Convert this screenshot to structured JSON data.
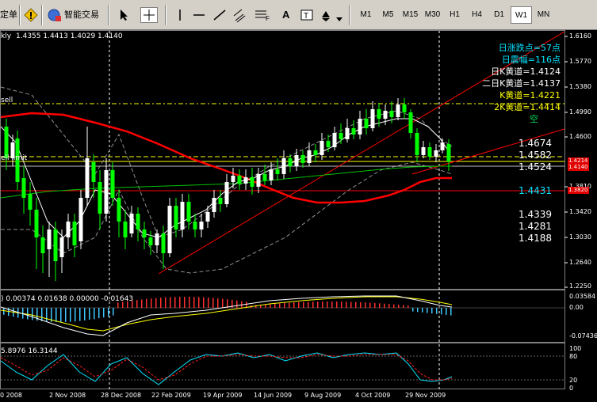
{
  "toolbar": {
    "label_left": "定单",
    "auto_trade_label": "智能交易",
    "text_tool_label": "A",
    "fib_tool_label": "F",
    "timeframes": [
      "M1",
      "M5",
      "M15",
      "M30",
      "H1",
      "H4",
      "D1",
      "W1",
      "MN"
    ],
    "active_timeframe": "W1"
  },
  "chart_header": {
    "symbol_suffix": "kly",
    "ohlc": "1.4355 1.4413 1.4029 1.4140"
  },
  "labels": {
    "sell": "sell",
    "sell_limit": "ell limit"
  },
  "info_panel": {
    "daily_change": "日涨跌点=57点",
    "daily_range": "日震幅=116点",
    "k_line1": "日K黄道=1.4124",
    "k_line2": "二日K黄道=1.4137",
    "k_line3": "K黄道=1.4221",
    "k_line4": "2K黄道=1.4414",
    "signal": "空"
  },
  "levels": {
    "l1": "1.4674",
    "l2": "1.4582",
    "l3": "1.4524",
    "l4": "1.4431",
    "l5": "1.4339",
    "l6": "1.4281",
    "l7": "1.4188"
  },
  "price_axis": [
    "1.6160",
    "1.5770",
    "1.5380",
    "1.4990",
    "1.4600",
    "1.3810",
    "1.3420",
    "1.3030",
    "1.2640",
    "1.2250"
  ],
  "price_boxes": {
    "upper1": "1.4214",
    "upper2": "1.4140",
    "lower": "1.3820"
  },
  "macd": {
    "values": ") 0.00374 0.01638 0.00000 -0.01643",
    "axis_top": "0.03584",
    "axis_mid": "0.00",
    "axis_bottom": "-0.07436"
  },
  "stoch": {
    "values": "5.8976 16.3144",
    "axis_top": "100",
    "axis_80": "80",
    "axis_20": "20",
    "axis_0": "0"
  },
  "dates": [
    "0 2008",
    "2 Nov 2008",
    "28 Dec 2008",
    "22 Feb 2009",
    "19 Apr 2009",
    "14 Jun 2009",
    "9 Aug 2009",
    "4 Oct 2009",
    "29 Nov 2009"
  ],
  "colors": {
    "bull": "#ffffff",
    "bear": "#00ff00",
    "ma_red": "#ff0000",
    "ma_green": "#00c000",
    "info_cyan": "#00e5ff",
    "info_yellow": "#ffff00",
    "level_white": "#ffffff",
    "level_cyan": "#00e5ff"
  }
}
